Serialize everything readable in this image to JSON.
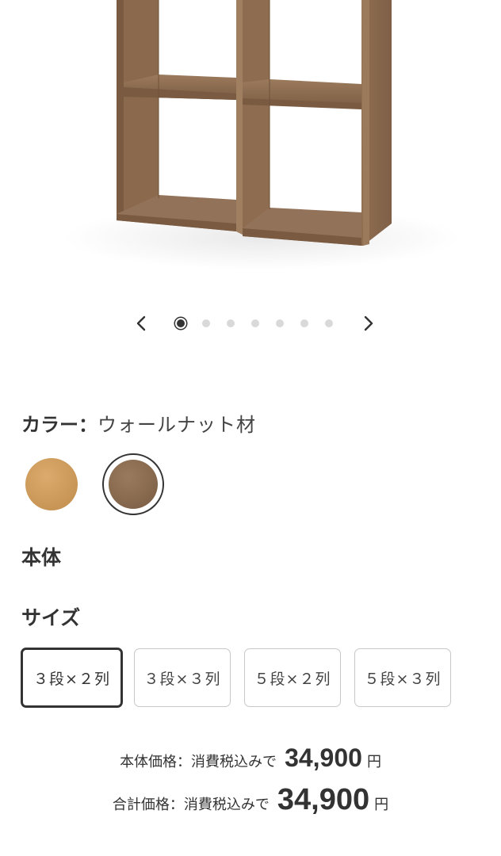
{
  "carousel": {
    "slide_count": 7,
    "current_slide": 1
  },
  "color": {
    "label": "カラー：",
    "selected_value": "ウォールナット材",
    "swatches": [
      {
        "name": "oak",
        "hex": "#cc9a5a",
        "selected": false
      },
      {
        "name": "walnut",
        "hex": "#886a4f",
        "selected": true
      }
    ]
  },
  "body_heading": "本体",
  "size": {
    "heading": "サイズ",
    "options": [
      {
        "label": "３段×２列",
        "selected": true
      },
      {
        "label": "３段×３列",
        "selected": false
      },
      {
        "label": "５段×２列",
        "selected": false
      },
      {
        "label": "５段×３列",
        "selected": false
      }
    ]
  },
  "price": {
    "body_label": "本体価格：消費税込みで",
    "body_amount": "34,900",
    "body_unit": "円",
    "total_label": "合計価格：消費税込みで",
    "total_amount": "34,900",
    "total_unit": "円"
  },
  "colors": {
    "text": "#333333",
    "border_inactive": "#c8c8c8",
    "dot_inactive": "#d9d9d9",
    "shelf_wood": "#8b6a4e"
  },
  "icons": {
    "prev": "chevron-left-icon",
    "next": "chevron-right-icon"
  }
}
